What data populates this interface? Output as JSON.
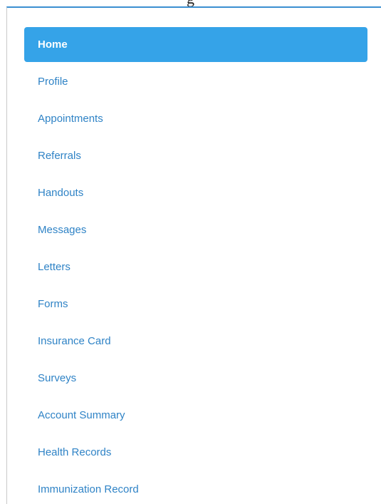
{
  "header": {
    "caption": "g"
  },
  "nav": {
    "accent_color": "#35a3e8",
    "link_color": "#2f83c6",
    "items": [
      {
        "label": "Home",
        "active": true
      },
      {
        "label": "Profile"
      },
      {
        "label": "Appointments"
      },
      {
        "label": "Referrals"
      },
      {
        "label": "Handouts"
      },
      {
        "label": "Messages"
      },
      {
        "label": "Letters"
      },
      {
        "label": "Forms"
      },
      {
        "label": "Insurance Card"
      },
      {
        "label": "Surveys"
      },
      {
        "label": "Account Summary"
      },
      {
        "label": "Health Records"
      },
      {
        "label": "Immunization Record"
      }
    ]
  }
}
